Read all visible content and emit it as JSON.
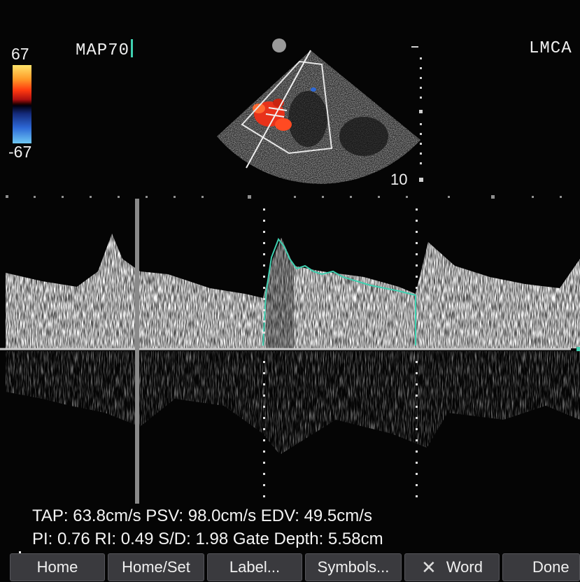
{
  "preset_label": "MAP70",
  "probe_label": "LMCA",
  "color_scale": {
    "max": "67",
    "min": "-67",
    "colors": [
      "#ffe46a",
      "#ff3a10",
      "#200000",
      "#2d68d6",
      "#6ec8f4"
    ]
  },
  "depth_marker": "10",
  "measurements": {
    "line1": "TAP: 63.8cm/s PSV: 98.0cm/s EDV: 49.5cm/s",
    "line2": "PI: 0.76 RI: 0.49 S/D: 1.98 Gate Depth: 5.58cm"
  },
  "toolbar": {
    "home": "Home",
    "home_set": "Home/Set",
    "label": "Label...",
    "symbols": "Symbols...",
    "word": "Word",
    "done": "Done"
  },
  "icons": {
    "word_icon": "close-x-icon"
  },
  "accent_color": "#3fd0b0"
}
